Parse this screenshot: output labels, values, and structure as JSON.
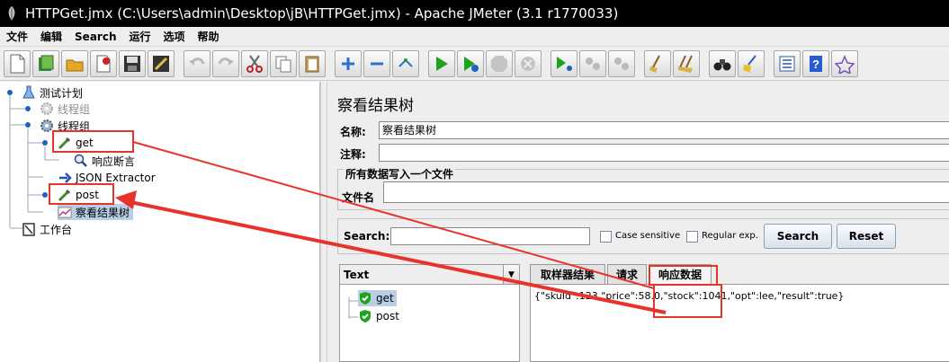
{
  "window": {
    "title": "HTTPGet.jmx (C:\\Users\\admin\\Desktop\\jB\\HTTPGet.jmx) - Apache JMeter (3.1 r1770033)"
  },
  "menu": [
    "文件",
    "编辑",
    "Search",
    "运行",
    "选项",
    "帮助"
  ],
  "toolbar": {
    "icons": [
      "new-icon",
      "templates-icon",
      "open-icon",
      "close-file-icon",
      "save-icon",
      "save-as-icon",
      "undo-icon",
      "redo-icon",
      "cut-icon",
      "copy-icon",
      "paste-icon",
      "expand-icon",
      "collapse-icon",
      "toggle-icon",
      "start-icon",
      "start-no-pause-icon",
      "stop-icon",
      "shutdown-icon",
      "remote-start-icon",
      "remote-stop-icon",
      "remote-shutdown-icon",
      "clear-icon",
      "clear-all-icon",
      "search-binoculars-icon",
      "reset-search-broom-icon",
      "function-helper-icon",
      "help-icon",
      "log-viewer-icon"
    ]
  },
  "tree": {
    "items": [
      {
        "label": "测试计划",
        "icon": "test-plan-flask-icon"
      },
      {
        "label": "线程组",
        "icon": "thread-group-gear-icon",
        "disabled": true
      },
      {
        "label": "线程组",
        "icon": "thread-group-gear-icon"
      },
      {
        "label": "get",
        "icon": "http-sampler-pipette-icon"
      },
      {
        "label": "响应断言",
        "icon": "assertion-magnifier-icon"
      },
      {
        "label": "JSON Extractor",
        "icon": "extractor-arrow-icon"
      },
      {
        "label": "post",
        "icon": "http-sampler-pipette-icon"
      },
      {
        "label": "察看结果树",
        "icon": "listener-chart-icon",
        "selected": true
      },
      {
        "label": "工作台",
        "icon": "workbench-icon"
      }
    ]
  },
  "panel": {
    "title": "察看结果树",
    "name_label": "名称:",
    "name_value": "察看结果树",
    "comment_label": "注释:",
    "comment_value": "",
    "file_group_label": "所有数据写入一个文件",
    "filename_label": "文件名",
    "filename_value": ""
  },
  "search": {
    "label": "Search:",
    "value": "",
    "case_sensitive": "Case sensitive",
    "regular_exp": "Regular exp.",
    "search_button": "Search",
    "reset_button": "Reset"
  },
  "results": {
    "renderer": "Text",
    "samples": [
      {
        "label": "get",
        "status": "success",
        "selected": true
      },
      {
        "label": "post",
        "status": "success"
      }
    ],
    "tabs": [
      "取样器结果",
      "请求",
      "响应数据"
    ],
    "active_tab": "响应数据",
    "response": "{\"skuId\":123,\"price\":58.0,\"stock\":1041,\"opt\":lee,\"result\":true}"
  },
  "annotation_colors": {
    "highlight": "#e8332a"
  }
}
